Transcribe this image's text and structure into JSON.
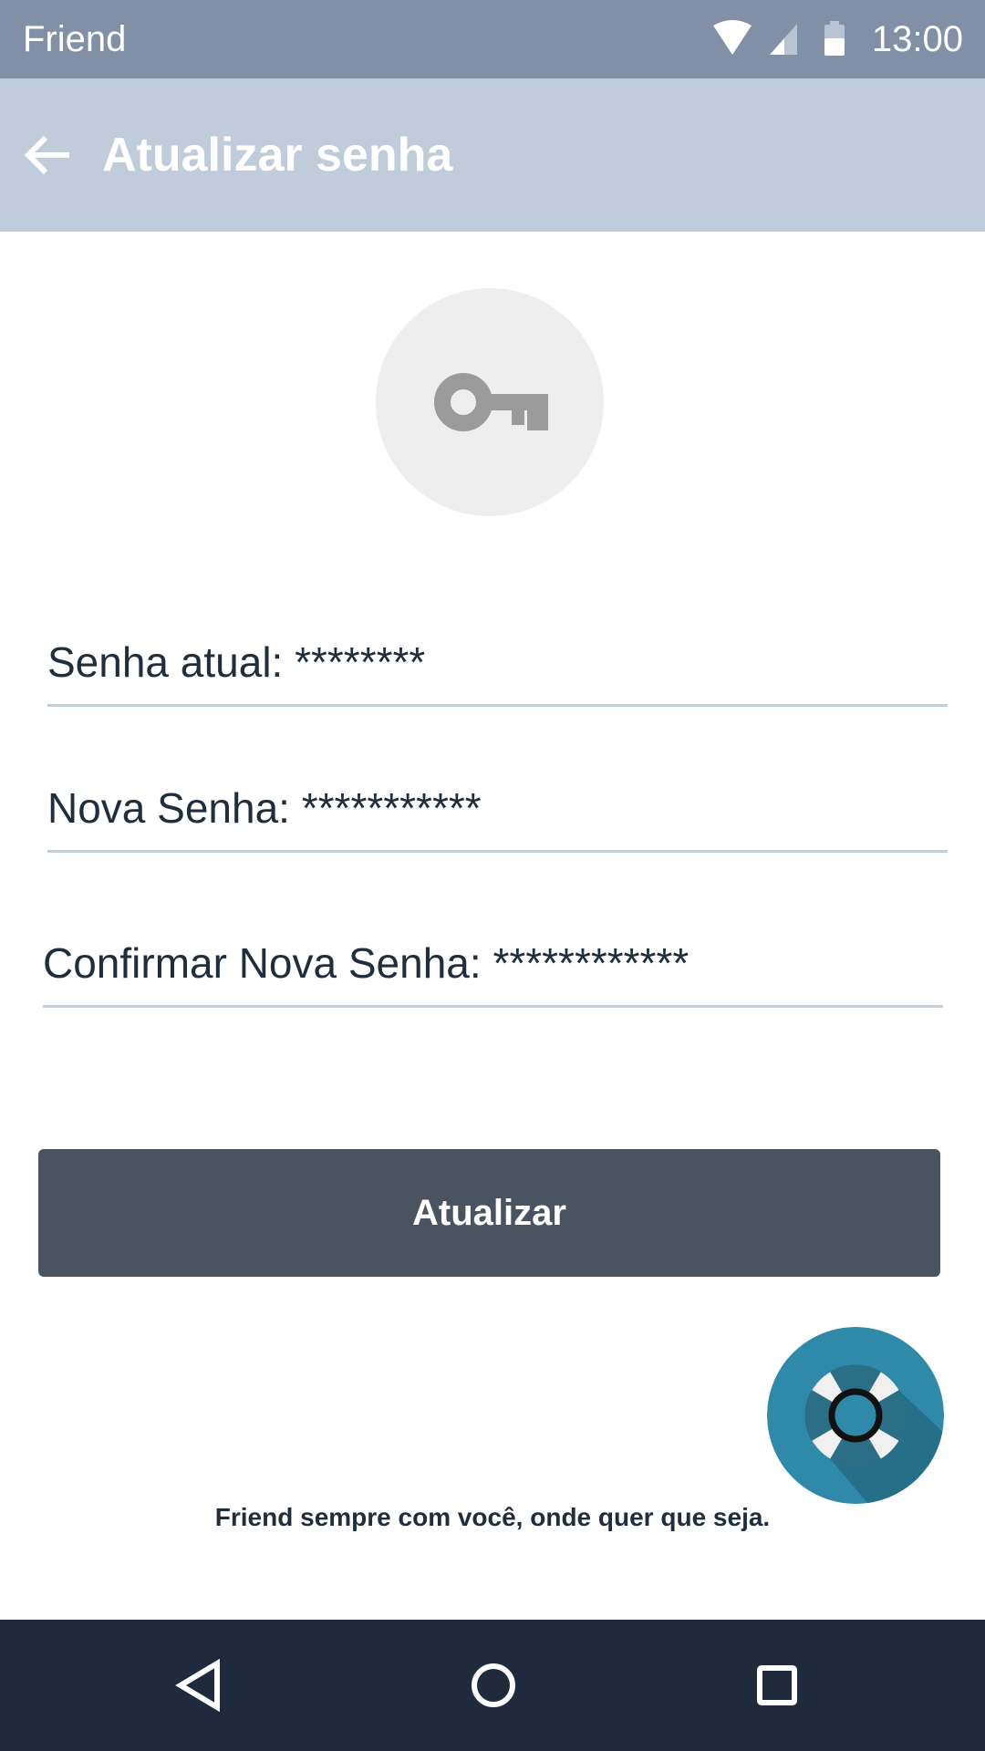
{
  "status_bar": {
    "app_name": "Friend",
    "time": "13:00",
    "icons": [
      "wifi-icon",
      "cell-signal-icon",
      "battery-icon"
    ]
  },
  "app_bar": {
    "title": "Atualizar senha",
    "back_icon": "arrow-left-icon"
  },
  "header_icon": "key-icon",
  "form": {
    "current_password": "Senha atual: ********",
    "new_password": "Nova Senha: ***********",
    "confirm_password": "Confirmar Nova Senha: ************",
    "submit_label": "Atualizar"
  },
  "help_fab_icon": "lifebuoy-icon",
  "tagline": "Friend sempre com você, onde quer que seja.",
  "nav": {
    "icons": [
      "back-triangle-icon",
      "home-circle-icon",
      "recents-square-icon"
    ]
  },
  "colors": {
    "status_bar": "#8190a6",
    "app_bar": "#c0ccd9",
    "button": "#4a5360",
    "fab": "#2e8aa8",
    "nav_bar": "#1f2b3c"
  }
}
